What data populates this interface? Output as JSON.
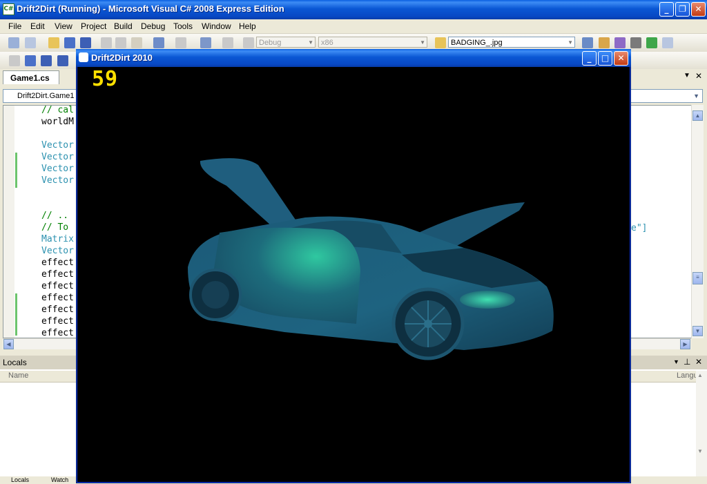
{
  "vs_window": {
    "title": "Drift2Dirt (Running) - Microsoft Visual C# 2008 Express Edition",
    "icon_text": "C#"
  },
  "menu": [
    "File",
    "Edit",
    "View",
    "Project",
    "Build",
    "Debug",
    "Tools",
    "Window",
    "Help"
  ],
  "toolbar": {
    "config_dropdown": "Debug",
    "platform_dropdown": "x86",
    "find_dropdown": "BADGING_.jpg"
  },
  "editor": {
    "tab_label": "Game1.cs",
    "class_combo": "Drift2Dirt.Game1",
    "code_lines": [
      {
        "text": "// cal",
        "type": "cm"
      },
      {
        "text": "worldM",
        "type": "pl"
      },
      {
        "text": "",
        "type": "pl"
      },
      {
        "text": "Vector",
        "type": "kw"
      },
      {
        "text": "Vector",
        "type": "kw"
      },
      {
        "text": "Vector",
        "type": "kw"
      },
      {
        "text": "Vector",
        "type": "kw"
      },
      {
        "text": "",
        "type": "pl"
      },
      {
        "text": "",
        "type": "pl"
      },
      {
        "text": "// ..",
        "type": "cm"
      },
      {
        "text": "// To",
        "type": "cm"
      },
      {
        "text": "Matrix",
        "type": "kw"
      },
      {
        "text": "Vector",
        "type": "kw"
      },
      {
        "text": "effect",
        "type": "pl"
      },
      {
        "text": "effect",
        "type": "pl"
      },
      {
        "text": "effect",
        "type": "pl"
      },
      {
        "text": "effect",
        "type": "pl"
      },
      {
        "text": "effect",
        "type": "pl"
      },
      {
        "text": "effect",
        "type": "pl"
      },
      {
        "text": "effect",
        "type": "pl"
      }
    ],
    "right_fragment": "e\"]"
  },
  "locals": {
    "title": "Locals",
    "col_name": "Name",
    "col_type": "Langu",
    "tab_locals": "Locals",
    "tab_watch": "Watch"
  },
  "game_window": {
    "title": "Drift2Dirt 2010",
    "fps": "59"
  },
  "colors": {
    "xp_blue": "#0A57D4",
    "car_body": "#1E5A75",
    "car_highlight": "#2FC8A0",
    "fps_yellow": "#FFE000"
  }
}
